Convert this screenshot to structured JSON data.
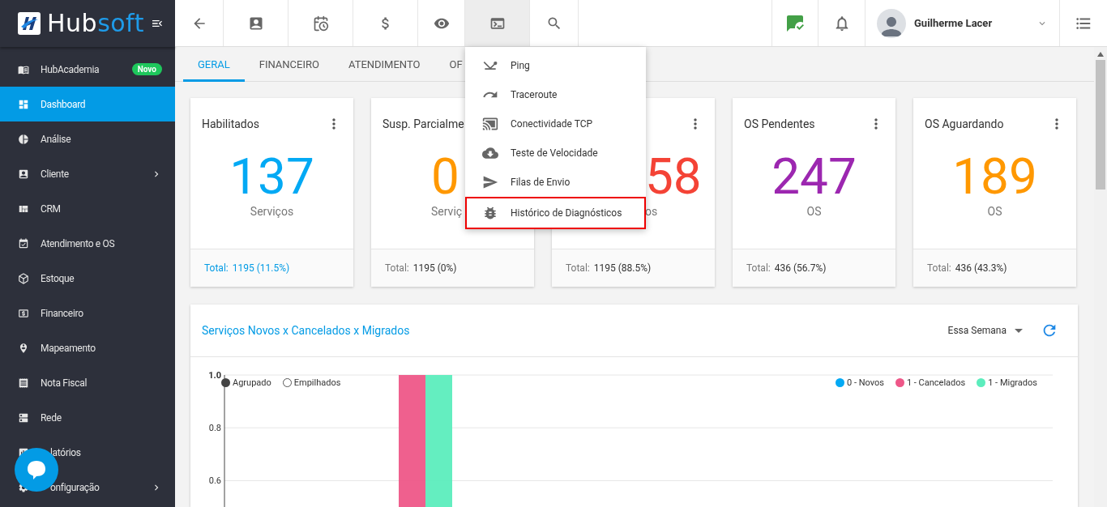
{
  "logo": {
    "part_1": "Hub",
    "part_2": "soft"
  },
  "sidebar": {
    "items": [
      {
        "label": "HubAcademia",
        "selected": false,
        "badge": "Novo",
        "has_submenu": false
      },
      {
        "label": "Dashboard",
        "selected": true,
        "has_submenu": false
      },
      {
        "label": "Análise",
        "selected": false,
        "has_submenu": false
      },
      {
        "label": "Cliente",
        "selected": false,
        "has_submenu": true
      },
      {
        "label": "CRM",
        "selected": false,
        "has_submenu": false
      },
      {
        "label": "Atendimento e OS",
        "selected": false,
        "has_submenu": false
      },
      {
        "label": "Estoque",
        "selected": false,
        "has_submenu": false
      },
      {
        "label": "Financeiro",
        "selected": false,
        "has_submenu": false
      },
      {
        "label": "Mapeamento",
        "selected": false,
        "has_submenu": false
      },
      {
        "label": "Nota Fiscal",
        "selected": false,
        "has_submenu": false
      },
      {
        "label": "Rede",
        "selected": false,
        "has_submenu": false
      },
      {
        "label": "latórios",
        "selected": false,
        "has_submenu": false
      },
      {
        "label": "onfiguração",
        "selected": false,
        "has_submenu": true
      }
    ]
  },
  "toolbar": {
    "buttons": [
      {
        "selected": false
      },
      {
        "selected": false
      },
      {
        "selected": false
      },
      {
        "selected": false
      },
      {
        "selected": false
      },
      {
        "selected": true
      },
      {
        "selected": false
      }
    ],
    "user": {
      "name": "Guilherme Lacer"
    }
  },
  "tabs": [
    {
      "label": "GERAL",
      "selected": true
    },
    {
      "label": "FINANCEIRO",
      "selected": false
    },
    {
      "label": "ATENDIMENTO",
      "selected": false
    },
    {
      "label": "OF",
      "selected": false
    }
  ],
  "cards": [
    {
      "title": "Habilitados",
      "value": "137",
      "unit": "Serviços",
      "color": "#03a9f4",
      "total_label": "Total:",
      "total": "1195 (11.5%)",
      "link": true
    },
    {
      "title": "Susp. Parcialme",
      "value": "0",
      "unit": "Serviç",
      "color": "#ff9800",
      "total_label": "Total:",
      "total": "1195 (0%)",
      "link": false
    },
    {
      "value": "58",
      "unit": "os",
      "color": "#f44336",
      "total_label": "Total:",
      "total": "1195 (88.5%)",
      "link": false
    },
    {
      "title": "OS Pendentes",
      "value": "247",
      "unit": "OS",
      "color": "#9c27b0",
      "total_label": "Total:",
      "total": "436 (56.7%)",
      "link": false
    },
    {
      "title": "OS Aguardando",
      "value": "189",
      "unit": "OS",
      "color": "#ff9800",
      "total_label": "Total:",
      "total": "436 (43.3%)",
      "link": false
    }
  ],
  "dropdown_menu": {
    "items": [
      {
        "label": "Ping",
        "highlighted": false
      },
      {
        "label": "Traceroute",
        "highlighted": false
      },
      {
        "label": "Conectividade TCP",
        "highlighted": false
      },
      {
        "label": "Teste de Velocidade",
        "highlighted": false
      },
      {
        "label": "Filas de Envio",
        "highlighted": false
      },
      {
        "label": "Histórico de Diagnósticos",
        "highlighted": true
      }
    ]
  },
  "chart_panel": {
    "title": "Serviços Novos x Cancelados x Migrados",
    "period": "Essa Semana",
    "modes": [
      {
        "label": "Agrupado",
        "selected": true
      },
      {
        "label": "Empilhados",
        "selected": false
      }
    ],
    "chart_data": {
      "type": "bar",
      "ylim": [
        0.5,
        1.0
      ],
      "yticks": [
        {
          "value": 0.6,
          "label": "0.6"
        },
        {
          "value": 0.8,
          "label": "0.8"
        },
        {
          "value": 1.0,
          "label": "1.0"
        }
      ],
      "series": [
        {
          "name": "0 - Novos",
          "color": "#03a9f4",
          "values": [
            null
          ]
        },
        {
          "name": "1 - Cancelados",
          "color": "#ee5788",
          "values": [
            1
          ]
        },
        {
          "name": "1 - Migrados",
          "color": "#5cedbd",
          "values": [
            1
          ]
        }
      ]
    }
  }
}
